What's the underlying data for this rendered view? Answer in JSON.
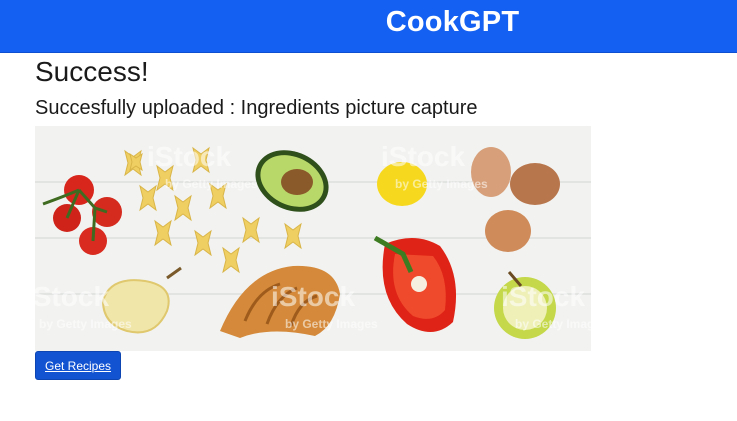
{
  "header": {
    "brand": "CookGPT"
  },
  "main": {
    "title": "Success!",
    "subtitle": "Succesfully uploaded : Ingredients picture capture",
    "photo": {
      "watermarks": [
        "iStock",
        "by Getty Images"
      ],
      "colors": {
        "tomato": "#d8261c",
        "pasta": "#f0cf62",
        "avocado": "#7cae35",
        "pepper": "#df2316",
        "egg": "#c98d5c",
        "lemon": "#f6d81e",
        "croissant": "#d48a3a",
        "apple": "#c4d84a",
        "pear": "#f1e6a9"
      }
    },
    "button": {
      "label": "Get Recipes"
    }
  },
  "colors": {
    "header_bg": "#1360f2",
    "button_bg": "#1253d1"
  }
}
